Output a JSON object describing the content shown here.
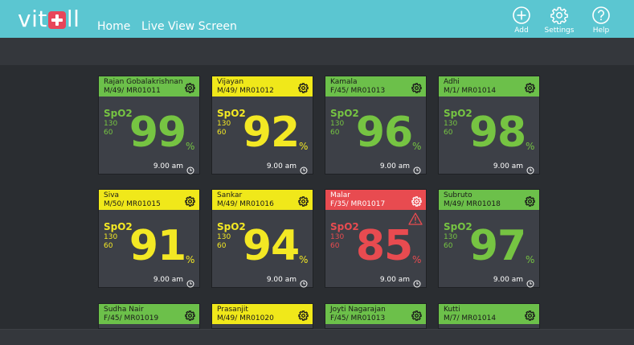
{
  "app": {
    "logo_prefix": "vit",
    "logo_suffix": "ll"
  },
  "nav": {
    "home": "Home",
    "live_view": "Live View Screen"
  },
  "toolbar": {
    "add": "Add",
    "settings": "Settings",
    "help": "Help"
  },
  "colors": {
    "topbar": "#5bc6d1",
    "normal": "#6cc04a",
    "caution": "#f0e81a",
    "alarm": "#e84b50"
  },
  "patients": [
    {
      "name": "Rajan Gobalakrishnan",
      "info": "M/49/ MR01011",
      "status": "green",
      "label": "SpO2",
      "line1": "130",
      "line2": "60",
      "value": "99",
      "unit": "%",
      "time": "9.00 am"
    },
    {
      "name": "Vijayan",
      "info": "M/49/ MR01012",
      "status": "yellow",
      "label": "SpO2",
      "line1": "130",
      "line2": "60",
      "value": "92",
      "unit": "%",
      "time": "9.00 am"
    },
    {
      "name": "Kamala",
      "info": "F/45/ MR01013",
      "status": "green",
      "label": "SpO2",
      "line1": "130",
      "line2": "60",
      "value": "96",
      "unit": "%",
      "time": "9.00 am"
    },
    {
      "name": "Adhi",
      "info": "M/1/ MR01014",
      "status": "green",
      "label": "SpO2",
      "line1": "130",
      "line2": "60",
      "value": "98",
      "unit": "%",
      "time": "9.00 am"
    },
    {
      "name": "Siva",
      "info": "M/50/ MR01015",
      "status": "yellow",
      "label": "SpO2",
      "line1": "130",
      "line2": "60",
      "value": "91",
      "unit": "%",
      "time": "9.00 am"
    },
    {
      "name": "Sankar",
      "info": "M/49/ MR01016",
      "status": "yellow",
      "label": "SpO2",
      "line1": "130",
      "line2": "60",
      "value": "94",
      "unit": "%",
      "time": "9.00 am"
    },
    {
      "name": "Malar",
      "info": "F/35/ MR01017",
      "status": "red",
      "label": "SpO2",
      "line1": "130",
      "line2": "60",
      "value": "85",
      "unit": "%",
      "time": "9.00 am",
      "alert": "warning-icon"
    },
    {
      "name": "Subruto",
      "info": "M/49/ MR01018",
      "status": "green",
      "label": "SpO2",
      "line1": "130",
      "line2": "60",
      "value": "97",
      "unit": "%",
      "time": "9.00 am"
    },
    {
      "name": "Sudha Nair",
      "info": "F/45/ MR01019",
      "status": "green"
    },
    {
      "name": "Prasanjit",
      "info": "M/49/ MR01020",
      "status": "yellow"
    },
    {
      "name": "Joyti Nagarajan",
      "info": "F/45/ MR01013",
      "status": "green"
    },
    {
      "name": "Kutti",
      "info": "M/7/ MR01014",
      "status": "green"
    }
  ]
}
